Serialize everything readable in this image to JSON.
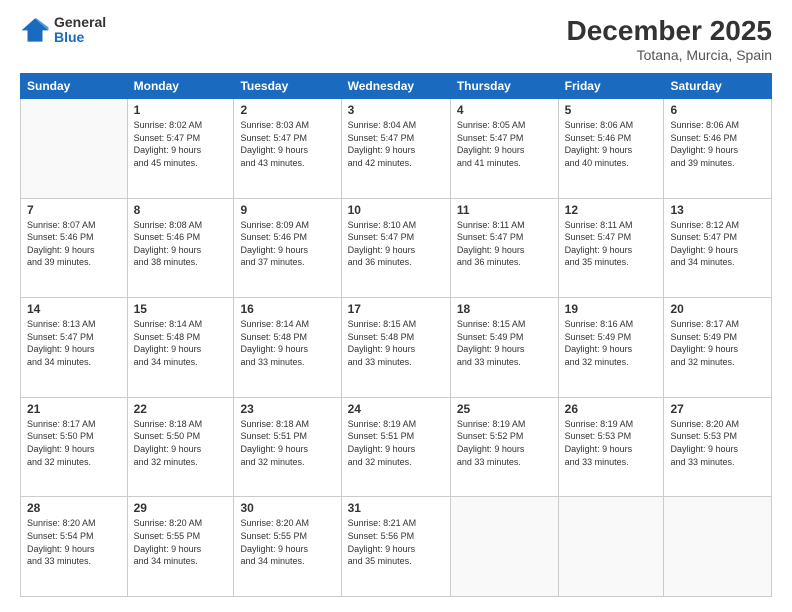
{
  "header": {
    "logo_general": "General",
    "logo_blue": "Blue",
    "main_title": "December 2025",
    "subtitle": "Totana, Murcia, Spain"
  },
  "calendar": {
    "days_of_week": [
      "Sunday",
      "Monday",
      "Tuesday",
      "Wednesday",
      "Thursday",
      "Friday",
      "Saturday"
    ],
    "weeks": [
      [
        {
          "day": "",
          "info": ""
        },
        {
          "day": "1",
          "info": "Sunrise: 8:02 AM\nSunset: 5:47 PM\nDaylight: 9 hours\nand 45 minutes."
        },
        {
          "day": "2",
          "info": "Sunrise: 8:03 AM\nSunset: 5:47 PM\nDaylight: 9 hours\nand 43 minutes."
        },
        {
          "day": "3",
          "info": "Sunrise: 8:04 AM\nSunset: 5:47 PM\nDaylight: 9 hours\nand 42 minutes."
        },
        {
          "day": "4",
          "info": "Sunrise: 8:05 AM\nSunset: 5:47 PM\nDaylight: 9 hours\nand 41 minutes."
        },
        {
          "day": "5",
          "info": "Sunrise: 8:06 AM\nSunset: 5:46 PM\nDaylight: 9 hours\nand 40 minutes."
        },
        {
          "day": "6",
          "info": "Sunrise: 8:06 AM\nSunset: 5:46 PM\nDaylight: 9 hours\nand 39 minutes."
        }
      ],
      [
        {
          "day": "7",
          "info": "Sunrise: 8:07 AM\nSunset: 5:46 PM\nDaylight: 9 hours\nand 39 minutes."
        },
        {
          "day": "8",
          "info": "Sunrise: 8:08 AM\nSunset: 5:46 PM\nDaylight: 9 hours\nand 38 minutes."
        },
        {
          "day": "9",
          "info": "Sunrise: 8:09 AM\nSunset: 5:46 PM\nDaylight: 9 hours\nand 37 minutes."
        },
        {
          "day": "10",
          "info": "Sunrise: 8:10 AM\nSunset: 5:47 PM\nDaylight: 9 hours\nand 36 minutes."
        },
        {
          "day": "11",
          "info": "Sunrise: 8:11 AM\nSunset: 5:47 PM\nDaylight: 9 hours\nand 36 minutes."
        },
        {
          "day": "12",
          "info": "Sunrise: 8:11 AM\nSunset: 5:47 PM\nDaylight: 9 hours\nand 35 minutes."
        },
        {
          "day": "13",
          "info": "Sunrise: 8:12 AM\nSunset: 5:47 PM\nDaylight: 9 hours\nand 34 minutes."
        }
      ],
      [
        {
          "day": "14",
          "info": "Sunrise: 8:13 AM\nSunset: 5:47 PM\nDaylight: 9 hours\nand 34 minutes."
        },
        {
          "day": "15",
          "info": "Sunrise: 8:14 AM\nSunset: 5:48 PM\nDaylight: 9 hours\nand 34 minutes."
        },
        {
          "day": "16",
          "info": "Sunrise: 8:14 AM\nSunset: 5:48 PM\nDaylight: 9 hours\nand 33 minutes."
        },
        {
          "day": "17",
          "info": "Sunrise: 8:15 AM\nSunset: 5:48 PM\nDaylight: 9 hours\nand 33 minutes."
        },
        {
          "day": "18",
          "info": "Sunrise: 8:15 AM\nSunset: 5:49 PM\nDaylight: 9 hours\nand 33 minutes."
        },
        {
          "day": "19",
          "info": "Sunrise: 8:16 AM\nSunset: 5:49 PM\nDaylight: 9 hours\nand 32 minutes."
        },
        {
          "day": "20",
          "info": "Sunrise: 8:17 AM\nSunset: 5:49 PM\nDaylight: 9 hours\nand 32 minutes."
        }
      ],
      [
        {
          "day": "21",
          "info": "Sunrise: 8:17 AM\nSunset: 5:50 PM\nDaylight: 9 hours\nand 32 minutes."
        },
        {
          "day": "22",
          "info": "Sunrise: 8:18 AM\nSunset: 5:50 PM\nDaylight: 9 hours\nand 32 minutes."
        },
        {
          "day": "23",
          "info": "Sunrise: 8:18 AM\nSunset: 5:51 PM\nDaylight: 9 hours\nand 32 minutes."
        },
        {
          "day": "24",
          "info": "Sunrise: 8:19 AM\nSunset: 5:51 PM\nDaylight: 9 hours\nand 32 minutes."
        },
        {
          "day": "25",
          "info": "Sunrise: 8:19 AM\nSunset: 5:52 PM\nDaylight: 9 hours\nand 33 minutes."
        },
        {
          "day": "26",
          "info": "Sunrise: 8:19 AM\nSunset: 5:53 PM\nDaylight: 9 hours\nand 33 minutes."
        },
        {
          "day": "27",
          "info": "Sunrise: 8:20 AM\nSunset: 5:53 PM\nDaylight: 9 hours\nand 33 minutes."
        }
      ],
      [
        {
          "day": "28",
          "info": "Sunrise: 8:20 AM\nSunset: 5:54 PM\nDaylight: 9 hours\nand 33 minutes."
        },
        {
          "day": "29",
          "info": "Sunrise: 8:20 AM\nSunset: 5:55 PM\nDaylight: 9 hours\nand 34 minutes."
        },
        {
          "day": "30",
          "info": "Sunrise: 8:20 AM\nSunset: 5:55 PM\nDaylight: 9 hours\nand 34 minutes."
        },
        {
          "day": "31",
          "info": "Sunrise: 8:21 AM\nSunset: 5:56 PM\nDaylight: 9 hours\nand 35 minutes."
        },
        {
          "day": "",
          "info": ""
        },
        {
          "day": "",
          "info": ""
        },
        {
          "day": "",
          "info": ""
        }
      ]
    ]
  }
}
